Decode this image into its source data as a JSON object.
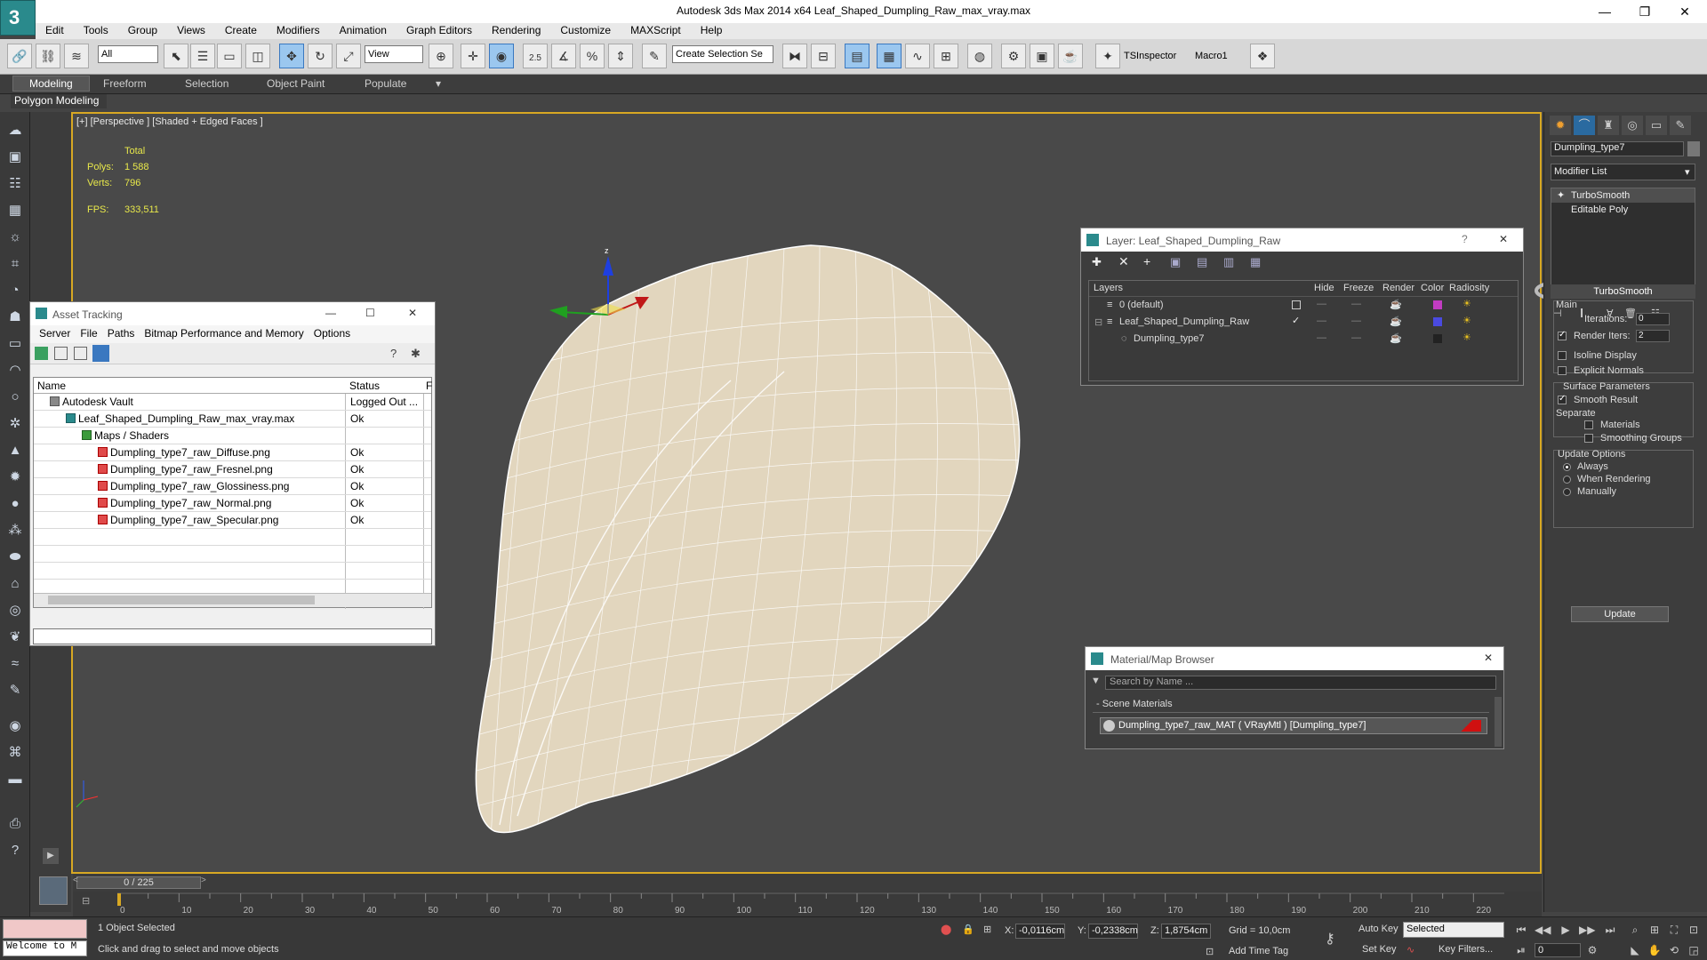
{
  "window": {
    "title": "Autodesk 3ds Max  2014 x64    Leaf_Shaped_Dumpling_Raw_max_vray.max",
    "minimize_glyph": "—",
    "restore_glyph": "❐",
    "close_glyph": "✕"
  },
  "menu": [
    "Edit",
    "Tools",
    "Group",
    "Views",
    "Create",
    "Modifiers",
    "Animation",
    "Graph Editors",
    "Rendering",
    "Customize",
    "MAXScript",
    "Help"
  ],
  "toolbar": {
    "selection_filter": "All",
    "ref_coord": "View",
    "snap_angle_label": "2.5",
    "named_selection_placeholder": "Create Selection Se",
    "tsinspector": "TSInspector",
    "macro": "Macro1"
  },
  "ribbon": {
    "tabs": [
      "Modeling",
      "Freeform",
      "Selection",
      "Object Paint",
      "Populate"
    ],
    "active_tab": "Modeling",
    "panel_label": "Polygon Modeling"
  },
  "viewport": {
    "label": "[+] [Perspective ] [Shaded + Edged Faces ]",
    "stats": {
      "header": "Total",
      "polys_label": "Polys:",
      "polys": "1 588",
      "verts_label": "Verts:",
      "verts": "796",
      "fps_label": "FPS:",
      "fps": "333,511"
    },
    "gizmo_axis": "z"
  },
  "asset_tracking": {
    "title": "Asset Tracking",
    "menu": [
      "Server",
      "File",
      "Paths",
      "Bitmap Performance and Memory",
      "Options"
    ],
    "columns": [
      "Name",
      "Status",
      "F"
    ],
    "rows": [
      {
        "name": "Autodesk Vault",
        "status": "Logged Out ...",
        "level": 1,
        "icon": "vault-icon"
      },
      {
        "name": "Leaf_Shaped_Dumpling_Raw_max_vray.max",
        "status": "Ok",
        "level": 2,
        "icon": "max-file-icon"
      },
      {
        "name": "Maps / Shaders",
        "status": "",
        "level": 3,
        "icon": "maps-icon"
      },
      {
        "name": "Dumpling_type7_raw_Diffuse.png",
        "status": "Ok",
        "level": 4,
        "icon": "image-file-icon"
      },
      {
        "name": "Dumpling_type7_raw_Fresnel.png",
        "status": "Ok",
        "level": 4,
        "icon": "image-file-icon"
      },
      {
        "name": "Dumpling_type7_raw_Glossiness.png",
        "status": "Ok",
        "level": 4,
        "icon": "image-file-icon"
      },
      {
        "name": "Dumpling_type7_raw_Normal.png",
        "status": "Ok",
        "level": 4,
        "icon": "image-file-icon"
      },
      {
        "name": "Dumpling_type7_raw_Specular.png",
        "status": "Ok",
        "level": 4,
        "icon": "image-file-icon"
      }
    ]
  },
  "layer_window": {
    "title": "Layer: Leaf_Shaped_Dumpling_Raw",
    "help_glyph": "?",
    "columns": [
      "Layers",
      "Hide",
      "Freeze",
      "Render",
      "Color",
      "Radiosity"
    ],
    "rows": [
      {
        "name": "0 (default)",
        "color": "#c23cc2",
        "current": false
      },
      {
        "name": "Leaf_Shaped_Dumpling_Raw",
        "color": "#4a4ae0",
        "current": true
      },
      {
        "name": "Dumpling_type7",
        "color": "#222222",
        "current": false
      }
    ]
  },
  "material_browser": {
    "title": "Material/Map Browser",
    "search_placeholder": "Search by Name ...",
    "group": "- Scene Materials",
    "material": "Dumpling_type7_raw_MAT  ( VRayMtl )  [Dumpling_type7]"
  },
  "command_panel": {
    "object_name": "Dumpling_type7",
    "modifier_list": "Modifier List",
    "stack": [
      "TurboSmooth",
      "Editable Poly"
    ],
    "rollout": "TurboSmooth",
    "main_label": "Main",
    "iterations_label": "Iterations:",
    "iterations": "0",
    "render_iters_label": "Render Iters:",
    "render_iters": "2",
    "isoline_label": "Isoline Display",
    "explicit_normals_label": "Explicit Normals",
    "surface_params_label": "Surface Parameters",
    "smooth_result_label": "Smooth Result",
    "separate_label": "Separate",
    "materials_label": "Materials",
    "smoothing_groups_label": "Smoothing Groups",
    "update_options_label": "Update Options",
    "always_label": "Always",
    "when_rendering_label": "When Rendering",
    "manually_label": "Manually",
    "update_button": "Update"
  },
  "timeline": {
    "slider": "0 / 225",
    "ticks": [
      "0",
      "10",
      "20",
      "30",
      "40",
      "50",
      "60",
      "70",
      "80",
      "90",
      "100",
      "110",
      "120",
      "130",
      "140",
      "150",
      "160",
      "170",
      "180",
      "190",
      "200",
      "210",
      "220"
    ]
  },
  "status": {
    "welcome": "Welcome to M",
    "selected": "1 Object Selected",
    "prompt": "Click and drag to select and move objects",
    "x_label": "X:",
    "x": "-0,0116cm",
    "y_label": "Y:",
    "y": "-0,2338cm",
    "z_label": "Z:",
    "z": "1,8754cm",
    "grid": "Grid = 10,0cm",
    "add_time_tag": "Add Time Tag",
    "auto_key": "Auto Key",
    "set_key": "Set Key",
    "selected_dropdown": "Selected",
    "key_filters": "Key Filters...",
    "frame": "0"
  },
  "colors": {
    "viewport_border": "#d8a823",
    "stats_text": "#e8e84a",
    "dumpling": "#e2d6be"
  }
}
